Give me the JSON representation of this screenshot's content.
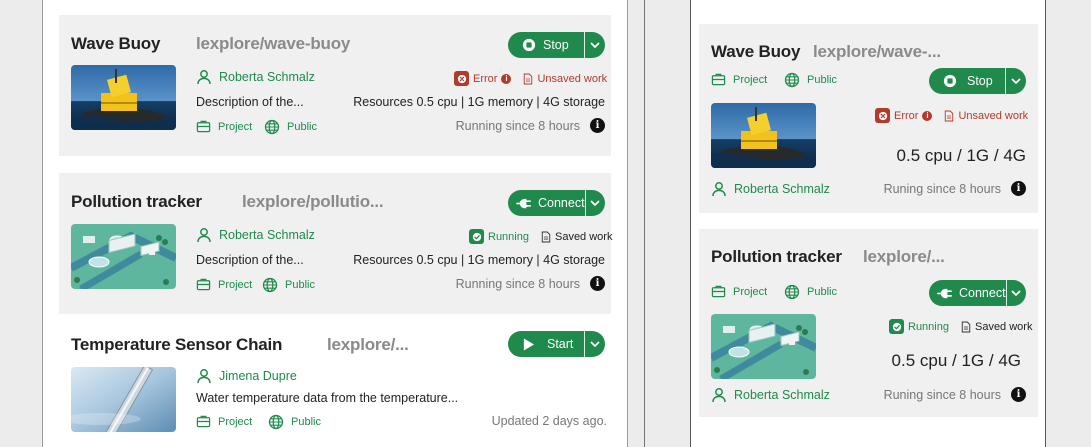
{
  "left": {
    "cards": [
      {
        "title": "Wave Buoy",
        "repo": "lexplore/wave-buoy",
        "owner": "Roberta Schmalz",
        "description": "Description of the...",
        "resources": "Resources 0.5 cpu | 1G memory | 4G storage",
        "status": "Error",
        "work": "Unsaved work",
        "project_label": "Project",
        "visibility_label": "Public",
        "time": "Running since 8 hours",
        "action_label": "Stop"
      },
      {
        "title": "Pollution tracker",
        "repo": "lexplore/pollutio...",
        "owner": "Roberta Schmalz",
        "description": "Description of the...",
        "resources": "Resources 0.5 cpu | 1G memory | 4G storage",
        "status": "Running",
        "work": "Saved work",
        "project_label": "Project",
        "visibility_label": "Public",
        "time": "Running since 8 hours",
        "action_label": "Connect"
      },
      {
        "title": "Temperature Sensor Chain",
        "repo": "lexplore/...",
        "owner": "Jimena Dupre",
        "description": "Water temperature data from the temperature...",
        "project_label": "Project",
        "visibility_label": "Public",
        "time": "Updated 2 days ago.",
        "action_label": "Start"
      }
    ]
  },
  "right": {
    "cards": [
      {
        "title": "Wave Buoy",
        "repo": "lexplore/wave-...",
        "project_label": "Project",
        "visibility_label": "Public",
        "action_label": "Stop",
        "status": "Error",
        "work": "Unsaved work",
        "resources": "0.5 cpu / 1G / 4G",
        "owner": "Roberta Schmalz",
        "time": "Runing since 8 hours"
      },
      {
        "title": "Pollution tracker",
        "repo": "lexplore/...",
        "project_label": "Project",
        "visibility_label": "Public",
        "action_label": "Connect",
        "status": "Running",
        "work": "Saved work",
        "resources": "0.5 cpu / 1G / 4G",
        "owner": "Roberta Schmalz",
        "time": "Runing since 8 hours"
      }
    ]
  },
  "colors": {
    "accent": "#1f8a4c",
    "error": "#b23a2c",
    "card_bg": "#f0f0f0"
  },
  "info_glyph": "i"
}
